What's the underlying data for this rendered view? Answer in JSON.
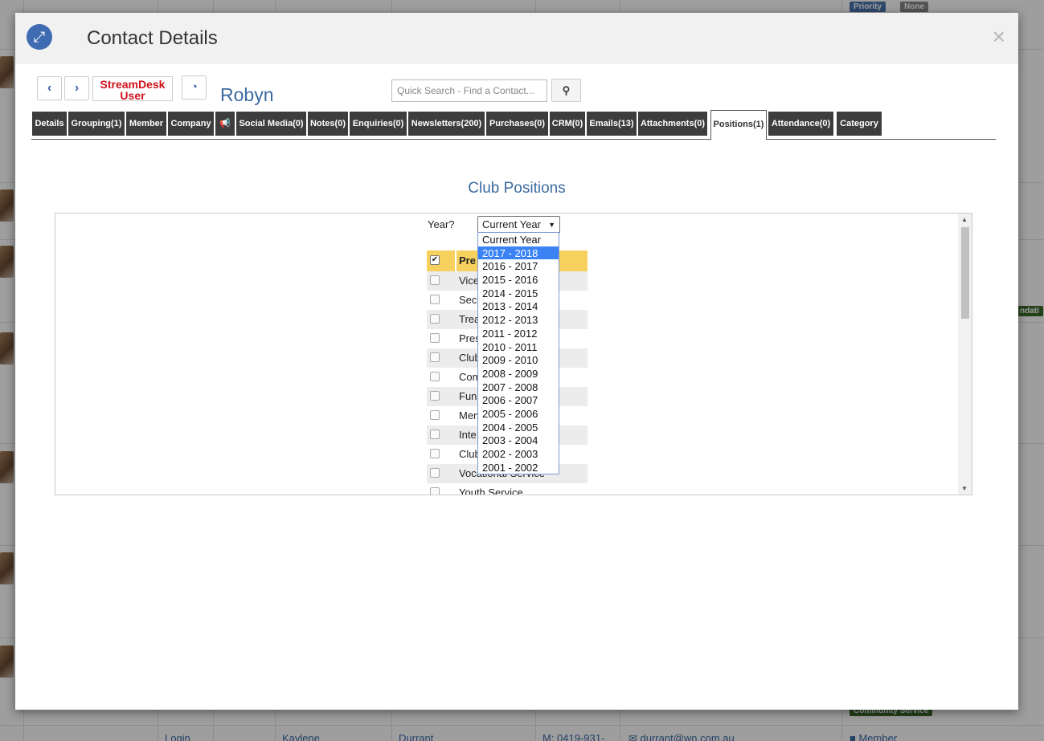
{
  "background": {
    "badges": {
      "priority": "Priority",
      "none": "None",
      "foundation": "ndati",
      "community": "Community Service",
      "member": "Member"
    },
    "last_row": {
      "login": "Login",
      "first_name": "Kaylene",
      "last_name": "Durrant",
      "phone": "M: 0419-931-",
      "email": "durrant@wn.com.au"
    }
  },
  "modal": {
    "title": "Contact Details",
    "expand_icon": "expand-arrows-icon",
    "close_symbol": "×"
  },
  "toolbar": {
    "prev_symbol": "‹",
    "next_symbol": "›",
    "logo_line1": "StreamDesk",
    "logo_line2": "User",
    "dashboard_icon": "dashboard-icon",
    "contact_name": "Robyn",
    "search_placeholder": "Quick Search - Find a Contact...",
    "search_icon": "search-icon"
  },
  "tabs": [
    {
      "label": "Details"
    },
    {
      "label": "Grouping(1)"
    },
    {
      "label": "Member"
    },
    {
      "label": "Company"
    },
    {
      "label": "📢"
    },
    {
      "label": "Social Media(0)"
    },
    {
      "label": "Notes(0)"
    },
    {
      "label": "Enquiries(0)"
    },
    {
      "label": "Newsletters(200)"
    },
    {
      "label": "Purchases(0)"
    },
    {
      "label": "CRM(0)"
    },
    {
      "label": "Emails(13)"
    },
    {
      "label": "Attachments(0)"
    },
    {
      "label": "Positions(1)"
    },
    {
      "label": "Attendance(0)"
    },
    {
      "label": "Category"
    }
  ],
  "active_tab": "Positions(1)",
  "positions": {
    "title": "Club Positions",
    "year_label": "Year?",
    "year_selected": "Current Year",
    "rows": [
      {
        "label": "Pre",
        "checked": true
      },
      {
        "label": "Vice",
        "checked": false
      },
      {
        "label": "Sec",
        "checked": false
      },
      {
        "label": "Trea",
        "checked": false
      },
      {
        "label": "Pres",
        "checked": false
      },
      {
        "label": "Club",
        "checked": false
      },
      {
        "label": "Com",
        "checked": false
      },
      {
        "label": "Fun",
        "checked": false
      },
      {
        "label": "Mem",
        "checked": false
      },
      {
        "label": "Inte",
        "checked": false
      },
      {
        "label": "Club",
        "checked": false
      },
      {
        "label": "Vocational Service",
        "checked": false
      },
      {
        "label": "Youth Service",
        "checked": false
      }
    ],
    "year_options": [
      "Current Year",
      "2017 - 2018",
      "2016 - 2017",
      "2015 - 2016",
      "2014 - 2015",
      "2013 - 2014",
      "2012 - 2013",
      "2011 - 2012",
      "2010 - 2011",
      "2009 - 2010",
      "2008 - 2009",
      "2007 - 2008",
      "2006 - 2007",
      "2005 - 2006",
      "2004 - 2005",
      "2003 - 2004",
      "2002 - 2003",
      "2001 - 2002"
    ],
    "highlighted_option": "2017 - 2018"
  },
  "colors": {
    "accent": "#3d6aa0",
    "tab_bg": "#3d3d3d",
    "header_row": "#f7d15e",
    "dropdown_highlight": "#3b83f5",
    "logo_red": "#d0121b"
  }
}
